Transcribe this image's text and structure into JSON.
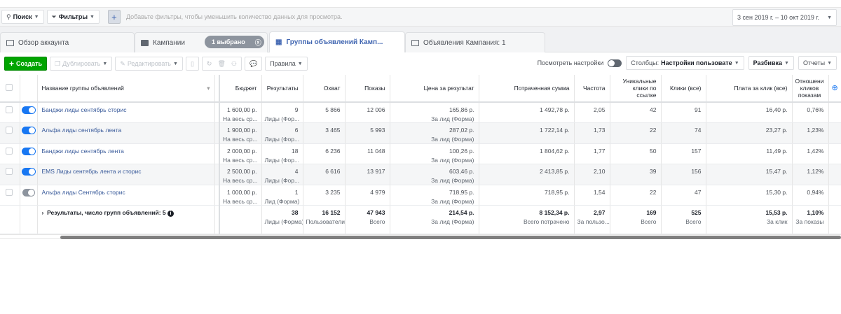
{
  "filterbar": {
    "search": "Поиск",
    "filters": "Фильтры",
    "add": "+",
    "hint": "Добавьте фильтры, чтобы уменьшить количество данных для просмотра.",
    "date_range": "3 сен 2019 г. – 10 окт 2019 г."
  },
  "tabs": [
    {
      "label": "Обзор аккаунта"
    },
    {
      "label": "Кампании"
    },
    {
      "label": "Группы объявлений Камп..."
    },
    {
      "label": "Объявления Кампания: 1"
    }
  ],
  "selected_badge": "1 выбрано",
  "toolbar": {
    "create": "Создать",
    "duplicate": "Дублировать",
    "edit": "Редактировать",
    "rules": "Правила",
    "view_settings": "Посмотреть настройки",
    "columns_prefix": "Столбцы:",
    "columns_value": "Настройки пользовате",
    "breakdown": "Разбивка",
    "reports": "Отчеты"
  },
  "columns": [
    "Название группы объявлений",
    "Бюджет",
    "Результаты",
    "Охват",
    "Показы",
    "Цена за результат",
    "Потраченная сумма",
    "Частота",
    "Уникальные клики по ссылке",
    "Клики (все)",
    "Плата за клик (все)",
    "Отношени кликов показам"
  ],
  "rows": [
    {
      "active": true,
      "name": "Банджи лиды сентябрь сторис",
      "budget": "1 600,00 р.",
      "budget_sub": "На весь ср...",
      "results": "9",
      "results_sub": "Лиды (Фор...",
      "reach": "5 866",
      "impressions": "12 006",
      "cpr": "165,86 р.",
      "cpr_sub": "За лид (Форма)",
      "spent": "1 492,78 р.",
      "frequency": "2,05",
      "unique_clicks": "42",
      "clicks": "91",
      "cpc": "16,40 р.",
      "ctr": "0,76%"
    },
    {
      "active": true,
      "name": "Альфа лиды сентябрь лента",
      "budget": "1 900,00 р.",
      "budget_sub": "На весь ср...",
      "results": "6",
      "results_sub": "Лиды (Фор...",
      "reach": "3 465",
      "impressions": "5 993",
      "cpr": "287,02 р.",
      "cpr_sub": "За лид (Форма)",
      "spent": "1 722,14 р.",
      "frequency": "1,73",
      "unique_clicks": "22",
      "clicks": "74",
      "cpc": "23,27 р.",
      "ctr": "1,23%"
    },
    {
      "active": true,
      "name": "Банджи лиды сентябрь лента",
      "budget": "2 000,00 р.",
      "budget_sub": "На весь ср...",
      "results": "18",
      "results_sub": "Лиды (Фор...",
      "reach": "6 236",
      "impressions": "11 048",
      "cpr": "100,26 р.",
      "cpr_sub": "За лид (Форма)",
      "spent": "1 804,62 р.",
      "frequency": "1,77",
      "unique_clicks": "50",
      "clicks": "157",
      "cpc": "11,49 р.",
      "ctr": "1,42%"
    },
    {
      "active": true,
      "name": "EMS Лиды сентябрь лента и сторис",
      "budget": "2 500,00 р.",
      "budget_sub": "На весь ср...",
      "results": "4",
      "results_sub": "Лиды (Фор...",
      "reach": "6 616",
      "impressions": "13 917",
      "cpr": "603,46 р.",
      "cpr_sub": "За лид (Форма)",
      "spent": "2 413,85 р.",
      "frequency": "2,10",
      "unique_clicks": "39",
      "clicks": "156",
      "cpc": "15,47 р.",
      "ctr": "1,12%"
    },
    {
      "active": false,
      "name": "Альфа лиды Сентябрь сторис",
      "budget": "1 000,00 р.",
      "budget_sub": "На весь ср...",
      "results": "1",
      "results_sub": "Лид (Форма)",
      "reach": "3 235",
      "impressions": "4 979",
      "cpr": "718,95 р.",
      "cpr_sub": "За лид (Форма)",
      "spent": "718,95 р.",
      "frequency": "1,54",
      "unique_clicks": "22",
      "clicks": "47",
      "cpc": "15,30 р.",
      "ctr": "0,94%"
    }
  ],
  "summary": {
    "label": "Результаты, число групп объявлений: 5",
    "results": "38",
    "results_sub": "Лиды (Форма)",
    "reach": "16 152",
    "reach_sub": "Пользователи",
    "impressions": "47 943",
    "impressions_sub": "Всего",
    "cpr": "214,54 р.",
    "cpr_sub": "За лид (Форма)",
    "spent": "8 152,34 р.",
    "spent_sub": "Всего потрачено",
    "frequency": "2,97",
    "frequency_sub": "За пользо...",
    "unique_clicks": "169",
    "unique_clicks_sub": "Всего",
    "clicks": "525",
    "clicks_sub": "Всего",
    "cpc": "15,53 р.",
    "cpc_sub": "За клик",
    "ctr": "1,10%",
    "ctr_sub": "За показы"
  },
  "colors": {
    "accent": "#4267b2",
    "create": "#00a400",
    "toggle_on": "#1877f2"
  }
}
